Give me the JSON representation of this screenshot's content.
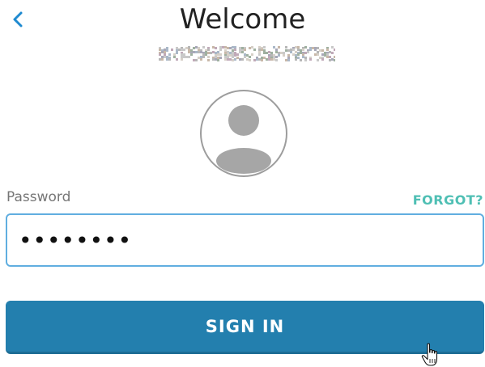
{
  "header": {
    "title": "Welcome",
    "back_icon": "chevron-left-icon"
  },
  "account": {
    "avatar_icon": "user-avatar-icon"
  },
  "password": {
    "label": "Password",
    "forgot_label": "FORGOT?",
    "value": "••••••••",
    "input_type": "password"
  },
  "actions": {
    "sign_in_label": "SIGN IN"
  },
  "colors": {
    "accent_blue": "#237fae",
    "input_border": "#60aee0",
    "forgot_teal": "#4fbfb4",
    "back_chevron": "#1e8ad0"
  },
  "cursor": {
    "icon": "hand-pointer-cursor-icon"
  }
}
